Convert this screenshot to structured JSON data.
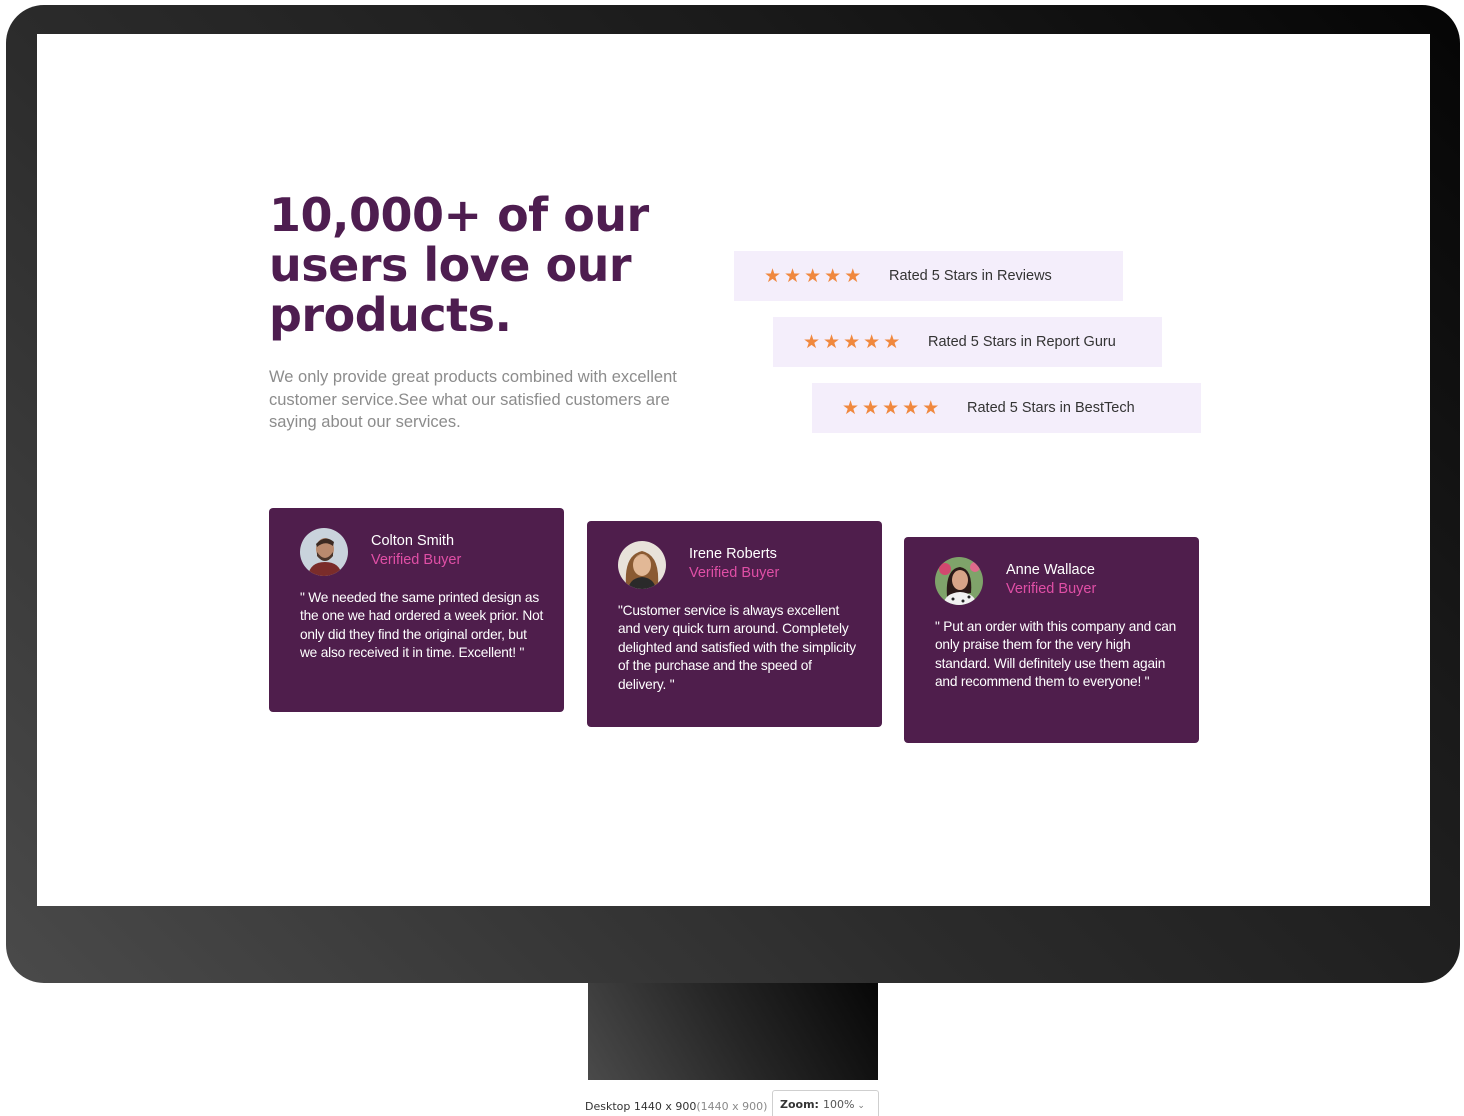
{
  "hero": {
    "title": "10,000+ of our users love our products.",
    "subtitle": "We only provide great products combined with excellent customer service.See what our satisfied customers are saying about our services."
  },
  "ratings": [
    {
      "stars": 5,
      "label": "Rated 5 Stars in Reviews"
    },
    {
      "stars": 5,
      "label": "Rated 5 Stars in Report Guru"
    },
    {
      "stars": 5,
      "label": "Rated 5 Stars in BestTech"
    }
  ],
  "testimonials": [
    {
      "name": "Colton Smith",
      "role": "Verified Buyer",
      "quote": "\" We needed the same printed design as the one we had ordered a week prior. Not only did they find the original order, but we also received it in time. Excellent! \""
    },
    {
      "name": "Irene Roberts",
      "role": "Verified Buyer",
      "quote": "\"Customer service is always excellent and very quick turn around. Completely delighted and satisfied with the simplicity of the purchase and the speed of delivery. \""
    },
    {
      "name": "Anne Wallace",
      "role": "Verified Buyer",
      "quote": "\" Put an order with this company and can only praise them for the very high standard. Will definitely use them again and recommend them to everyone! \""
    }
  ],
  "device": {
    "label": "Desktop 1440 x 900",
    "dims": "(1440 x 900)",
    "zoom_label": "Zoom:",
    "zoom_value": "100%"
  },
  "colors": {
    "brand_purple": "#4f1e4c",
    "headline": "#4e1d50",
    "accent_pink": "#e04fa6",
    "star_orange": "#f0883e",
    "rating_bg": "#f4eefb"
  },
  "icons": {
    "star": "star-icon",
    "chevron": "chevron-down-icon"
  }
}
